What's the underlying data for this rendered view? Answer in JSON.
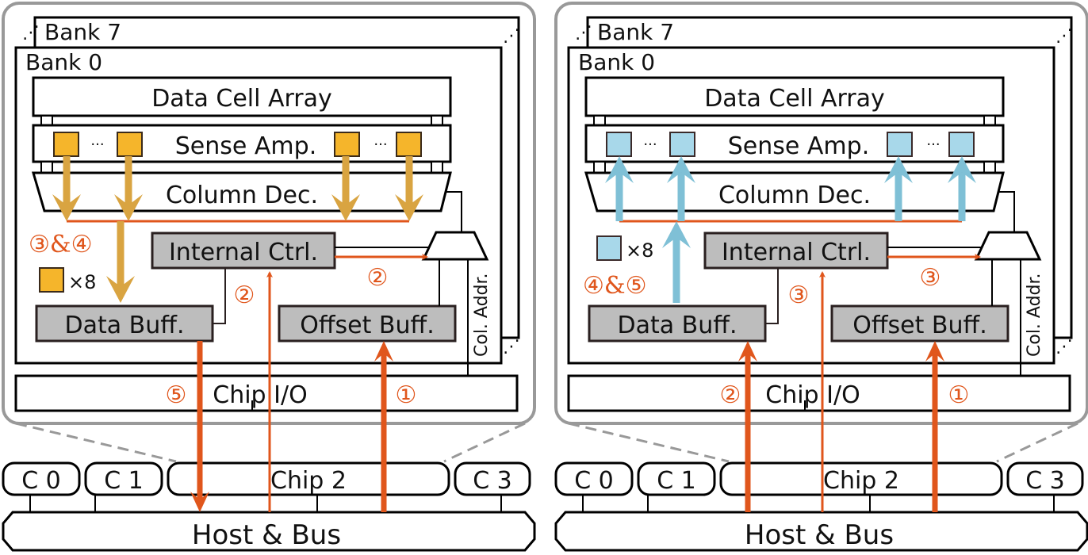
{
  "colors": {
    "orange": "#e0561c",
    "gold_arrow": "#d9a441",
    "gold_cell": "#f5b52b",
    "blue_arrow": "#7fc0d6",
    "blue_cell": "#a8d8ea",
    "gray_box": "#bdbdbd",
    "panel_border": "#999999"
  },
  "panels": [
    {
      "id": "read",
      "bank_back": "Bank 7",
      "bank_front": "Bank 0",
      "data_cell_array": "Data Cell Array",
      "sense_amp": "Sense Amp.",
      "column_dec": "Column Dec.",
      "internal_ctrl": "Internal Ctrl.",
      "data_buff": "Data Buff.",
      "offset_buff": "Offset Buff.",
      "col_addr": "Col. Addr.",
      "chip_io": "Chip I/O",
      "ellipsis": "···",
      "multiplier": "×8",
      "step_data_path": "③&④",
      "step_ctrl_mux": "②",
      "step_ctrl_in": "②",
      "step_io_left": "⑤",
      "step_io_right": "①",
      "chips": [
        "C 0",
        "C 1",
        "Chip 2",
        "C 3"
      ],
      "host": "Host & Bus"
    },
    {
      "id": "write",
      "bank_back": "Bank 7",
      "bank_front": "Bank 0",
      "data_cell_array": "Data Cell Array",
      "sense_amp": "Sense Amp.",
      "column_dec": "Column Dec.",
      "internal_ctrl": "Internal Ctrl.",
      "data_buff": "Data Buff.",
      "offset_buff": "Offset Buff.",
      "col_addr": "Col. Addr.",
      "chip_io": "Chip I/O",
      "ellipsis": "···",
      "multiplier": "×8",
      "step_data_path": "④&⑤",
      "step_ctrl_mux": "③",
      "step_ctrl_in": "③",
      "step_io_left": "②",
      "step_io_right": "①",
      "chips": [
        "C 0",
        "C 1",
        "Chip 2",
        "C 3"
      ],
      "host": "Host & Bus"
    }
  ]
}
